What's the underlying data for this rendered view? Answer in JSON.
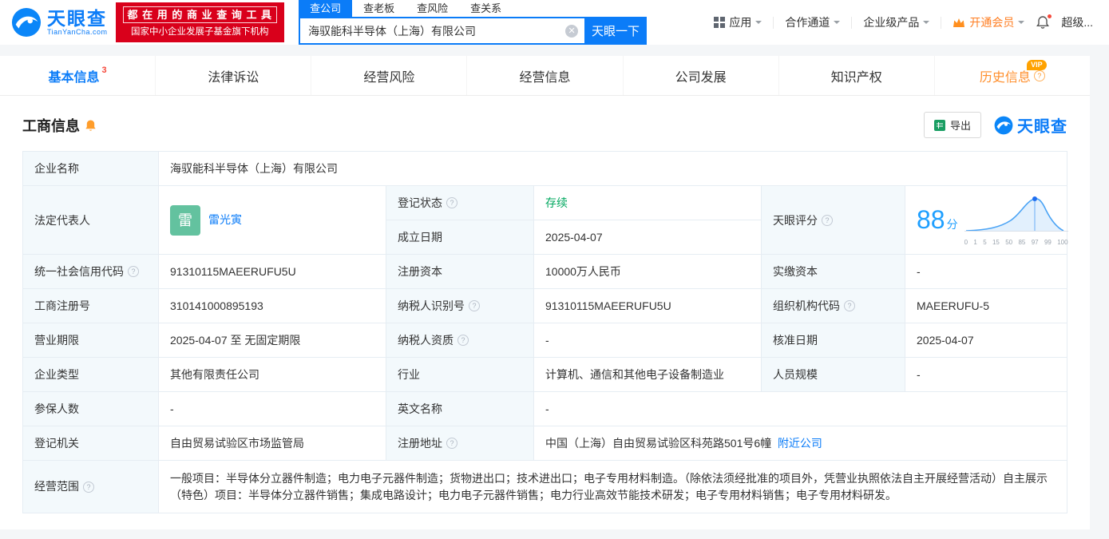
{
  "brand": {
    "name": "天眼查",
    "domain": "TianYanCha.com",
    "slogan_line1": "都 在 用 的 商 业 查 询 工 具",
    "slogan_line2": "国家中小企业发展子基金旗下机构"
  },
  "search": {
    "tabs": [
      "查公司",
      "查老板",
      "查风险",
      "查关系"
    ],
    "value": "海驭能科半导体（上海）有限公司",
    "button_label": "天眼一下"
  },
  "topnav": {
    "apps": "应用",
    "cooperation": "合作通道",
    "enterprise": "企业级产品",
    "vip": "开通会员",
    "super": "超级..."
  },
  "tabs": [
    {
      "label": "基本信息",
      "badge": "3"
    },
    {
      "label": "法律诉讼"
    },
    {
      "label": "经营风险"
    },
    {
      "label": "经营信息"
    },
    {
      "label": "公司发展"
    },
    {
      "label": "知识产权"
    },
    {
      "label": "历史信息",
      "vip_tag": "VIP"
    }
  ],
  "section": {
    "title": "工商信息",
    "export_label": "导出",
    "brand_mark": "天眼查"
  },
  "score": {
    "value": "88",
    "unit": "分",
    "axis": [
      "0",
      "1",
      "5",
      "15",
      "50",
      "85",
      "97",
      "99",
      "100"
    ]
  },
  "fields": {
    "company_name_label": "企业名称",
    "company_name": "海驭能科半导体（上海）有限公司",
    "legal_rep_label": "法定代表人",
    "legal_rep_avatar": "雷",
    "legal_rep_name": "雷光寅",
    "reg_status_label": "登记状态",
    "reg_status": "存续",
    "score_label": "天眼评分",
    "est_date_label": "成立日期",
    "est_date": "2025-04-07",
    "credit_code_label": "统一社会信用代码",
    "credit_code": "91310115MAEERUFU5U",
    "reg_capital_label": "注册资本",
    "reg_capital": "10000万人民币",
    "paid_capital_label": "实缴资本",
    "paid_capital": "-",
    "reg_number_label": "工商注册号",
    "reg_number": "310141000895193",
    "taxpayer_id_label": "纳税人识别号",
    "taxpayer_id": "91310115MAEERUFU5U",
    "org_code_label": "组织机构代码",
    "org_code": "MAEERUFU-5",
    "business_term_label": "营业期限",
    "business_term": "2025-04-07 至 无固定期限",
    "taxpayer_qual_label": "纳税人资质",
    "taxpayer_qual": "-",
    "approval_date_label": "核准日期",
    "approval_date": "2025-04-07",
    "company_type_label": "企业类型",
    "company_type": "其他有限责任公司",
    "industry_label": "行业",
    "industry": "计算机、通信和其他电子设备制造业",
    "staff_size_label": "人员规模",
    "staff_size": "-",
    "insured_label": "参保人数",
    "insured": "-",
    "english_name_label": "英文名称",
    "english_name": "-",
    "reg_authority_label": "登记机关",
    "reg_authority": "自由贸易试验区市场监管局",
    "reg_address_label": "注册地址",
    "reg_address": "中国（上海）自由贸易试验区科苑路501号6幢",
    "nearby_company_link": "附近公司",
    "business_scope_label": "经营范围",
    "business_scope": "一般项目：半导体分立器件制造；电力电子元器件制造；货物进出口；技术进出口；电子专用材料制造。（除依法须经批准的项目外，凭营业执照依法自主开展经营活动）自主展示（特色）项目：半导体分立器件销售；集成电路设计；电力电子元器件销售；电力行业高效节能技术研发；电子专用材料销售；电子专用材料研发。"
  }
}
